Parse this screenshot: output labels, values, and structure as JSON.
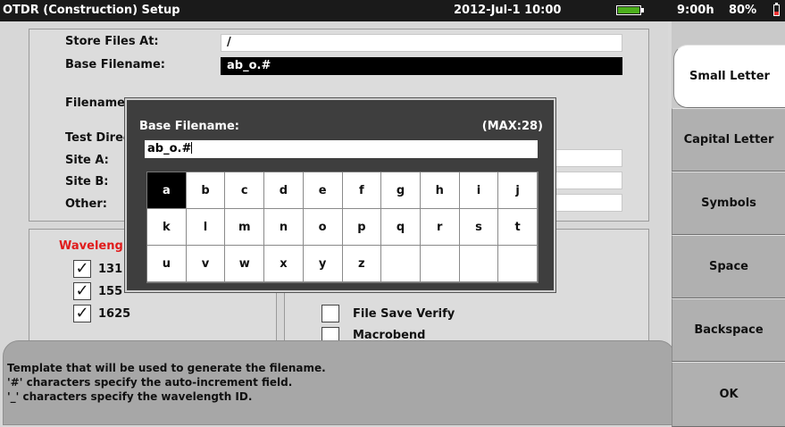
{
  "statusbar": {
    "title": "OTDR (Construction) Setup",
    "datetime": "2012-Jul-1 10:00",
    "time_remaining": "9:00h",
    "battery_percent": "80%",
    "colors": {
      "battery_ok": "#4caf1c",
      "battery_low": "#e33333"
    }
  },
  "form": {
    "store_files_label": "Store Files At:",
    "store_files_value": "/",
    "base_filename_label": "Base Filename:",
    "base_filename_value": "ab_o.#",
    "filename_label": "Filename:",
    "test_direction_label": "Test Direc",
    "site_a_label": "Site A:",
    "site_b_label": "Site B:",
    "other_label": "Other:"
  },
  "wavelength": {
    "heading": "Waveleng",
    "items": [
      {
        "label": "131",
        "checked": true
      },
      {
        "label": "155",
        "checked": true
      },
      {
        "label": "1625",
        "checked": true
      }
    ]
  },
  "options": {
    "file_save_verify": {
      "label": "File Save Verify",
      "checked": false
    },
    "macrobend": {
      "label": "Macrobend",
      "checked": false
    }
  },
  "keyboard_dialog": {
    "title": "Base Filename:",
    "max_label": "(MAX:28)",
    "input_value": "ab_o.#",
    "keys": [
      [
        "a",
        "b",
        "c",
        "d",
        "e",
        "f",
        "g",
        "h",
        "i",
        "j"
      ],
      [
        "k",
        "l",
        "m",
        "n",
        "o",
        "p",
        "q",
        "r",
        "s",
        "t"
      ],
      [
        "u",
        "v",
        "w",
        "x",
        "y",
        "z",
        "",
        "",
        "",
        ""
      ]
    ],
    "selected_key": "a"
  },
  "help": {
    "line1": "Template that will be used to generate the filename.",
    "line2": "'#' characters specify the auto-increment field.",
    "line3": "'_' characters specify the wavelength ID."
  },
  "softkeys": {
    "small_letter": "Small Letter",
    "capital_letter": "Capital Letter",
    "symbols": "Symbols",
    "space": "Space",
    "backspace": "Backspace",
    "ok": "OK"
  },
  "check_glyph": "✓"
}
